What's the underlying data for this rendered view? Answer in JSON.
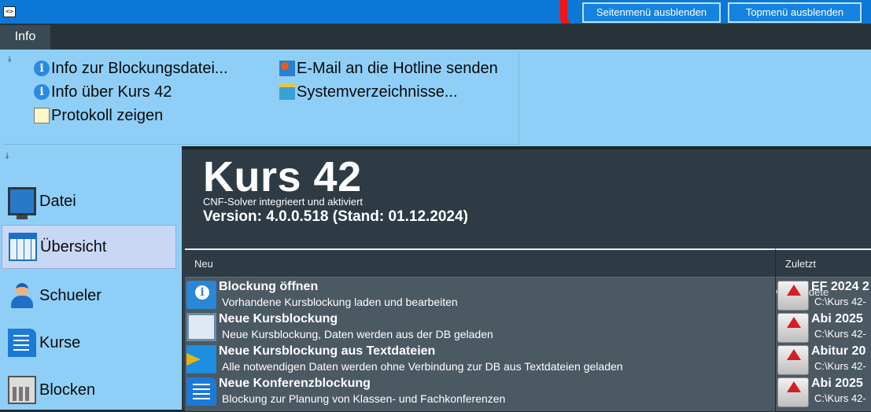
{
  "titlebar": {
    "side_menu_button": "Seitenmenü ausblenden",
    "top_menu_button": "Topmenü ausblenden"
  },
  "ribbon": {
    "tabs": [
      {
        "label": "Info"
      }
    ],
    "items": [
      {
        "label": "Info zur Blockungsdatei...",
        "icon": "info-icon"
      },
      {
        "label": "Info über Kurs 42",
        "icon": "info-icon"
      },
      {
        "label": "Protokoll zeigen",
        "icon": "protocol-icon"
      },
      {
        "label": "E-Mail an die Hotline senden",
        "icon": "bug-mail-icon"
      },
      {
        "label": "Systemverzeichnisse...",
        "icon": "folder-icon"
      }
    ]
  },
  "sidebar": {
    "items": [
      {
        "label": "Datei",
        "icon": "monitor-icon"
      },
      {
        "label": "Übersicht",
        "icon": "grid-icon",
        "active": true
      },
      {
        "label": "Schueler",
        "icon": "person-icon"
      },
      {
        "label": "Kurse",
        "icon": "document-icon"
      },
      {
        "label": "Blocken",
        "icon": "calculator-icon"
      }
    ]
  },
  "main": {
    "title": "Kurs 42",
    "solver": "CNF-Solver integrieert und aktiviert",
    "version": "Version: 4.0.0.518 (Stand: 01.12.2024)",
    "new_panel": {
      "header": "Neu",
      "entries": [
        {
          "title": "Blockung öffnen",
          "desc": "Vorhandene Kursblockung laden und bearbeiten",
          "icon": "open-info-icon"
        },
        {
          "title": "Neue Kursblockung",
          "desc": "Neue Kursblockung, Daten werden aus der DB geladen",
          "icon": "screen-icon"
        },
        {
          "title": "Neue Kursblockung aus Textdateien",
          "desc": "Alle notwendigen Daten werden ohne Verbindung zur DB aus Textdateien geladen",
          "icon": "door-icon"
        },
        {
          "title": "Neue Konferenzblockung",
          "desc": "Blockung zur Planung von Klassen- und Fachkonferenzen",
          "icon": "sheet-icon"
        }
      ]
    },
    "recent_panel": {
      "header": "Zuletzt verwendete",
      "entries": [
        {
          "title": "EF 2024 2",
          "path": "C:\\Kurs 42-"
        },
        {
          "title": "Abi 2025",
          "path": "C:\\Kurs 42-"
        },
        {
          "title": "Abitur 20",
          "path": "C:\\Kurs 42-"
        },
        {
          "title": "Abi 2025",
          "path": "C:\\Kurs 42-"
        }
      ]
    }
  },
  "colors": {
    "titlebar": "#0d77d6",
    "ribbon": "#8fcff7",
    "main_bg": "#2e3b44",
    "panel_bg": "#4b5962",
    "annotation_red": "#ff0f0f"
  }
}
